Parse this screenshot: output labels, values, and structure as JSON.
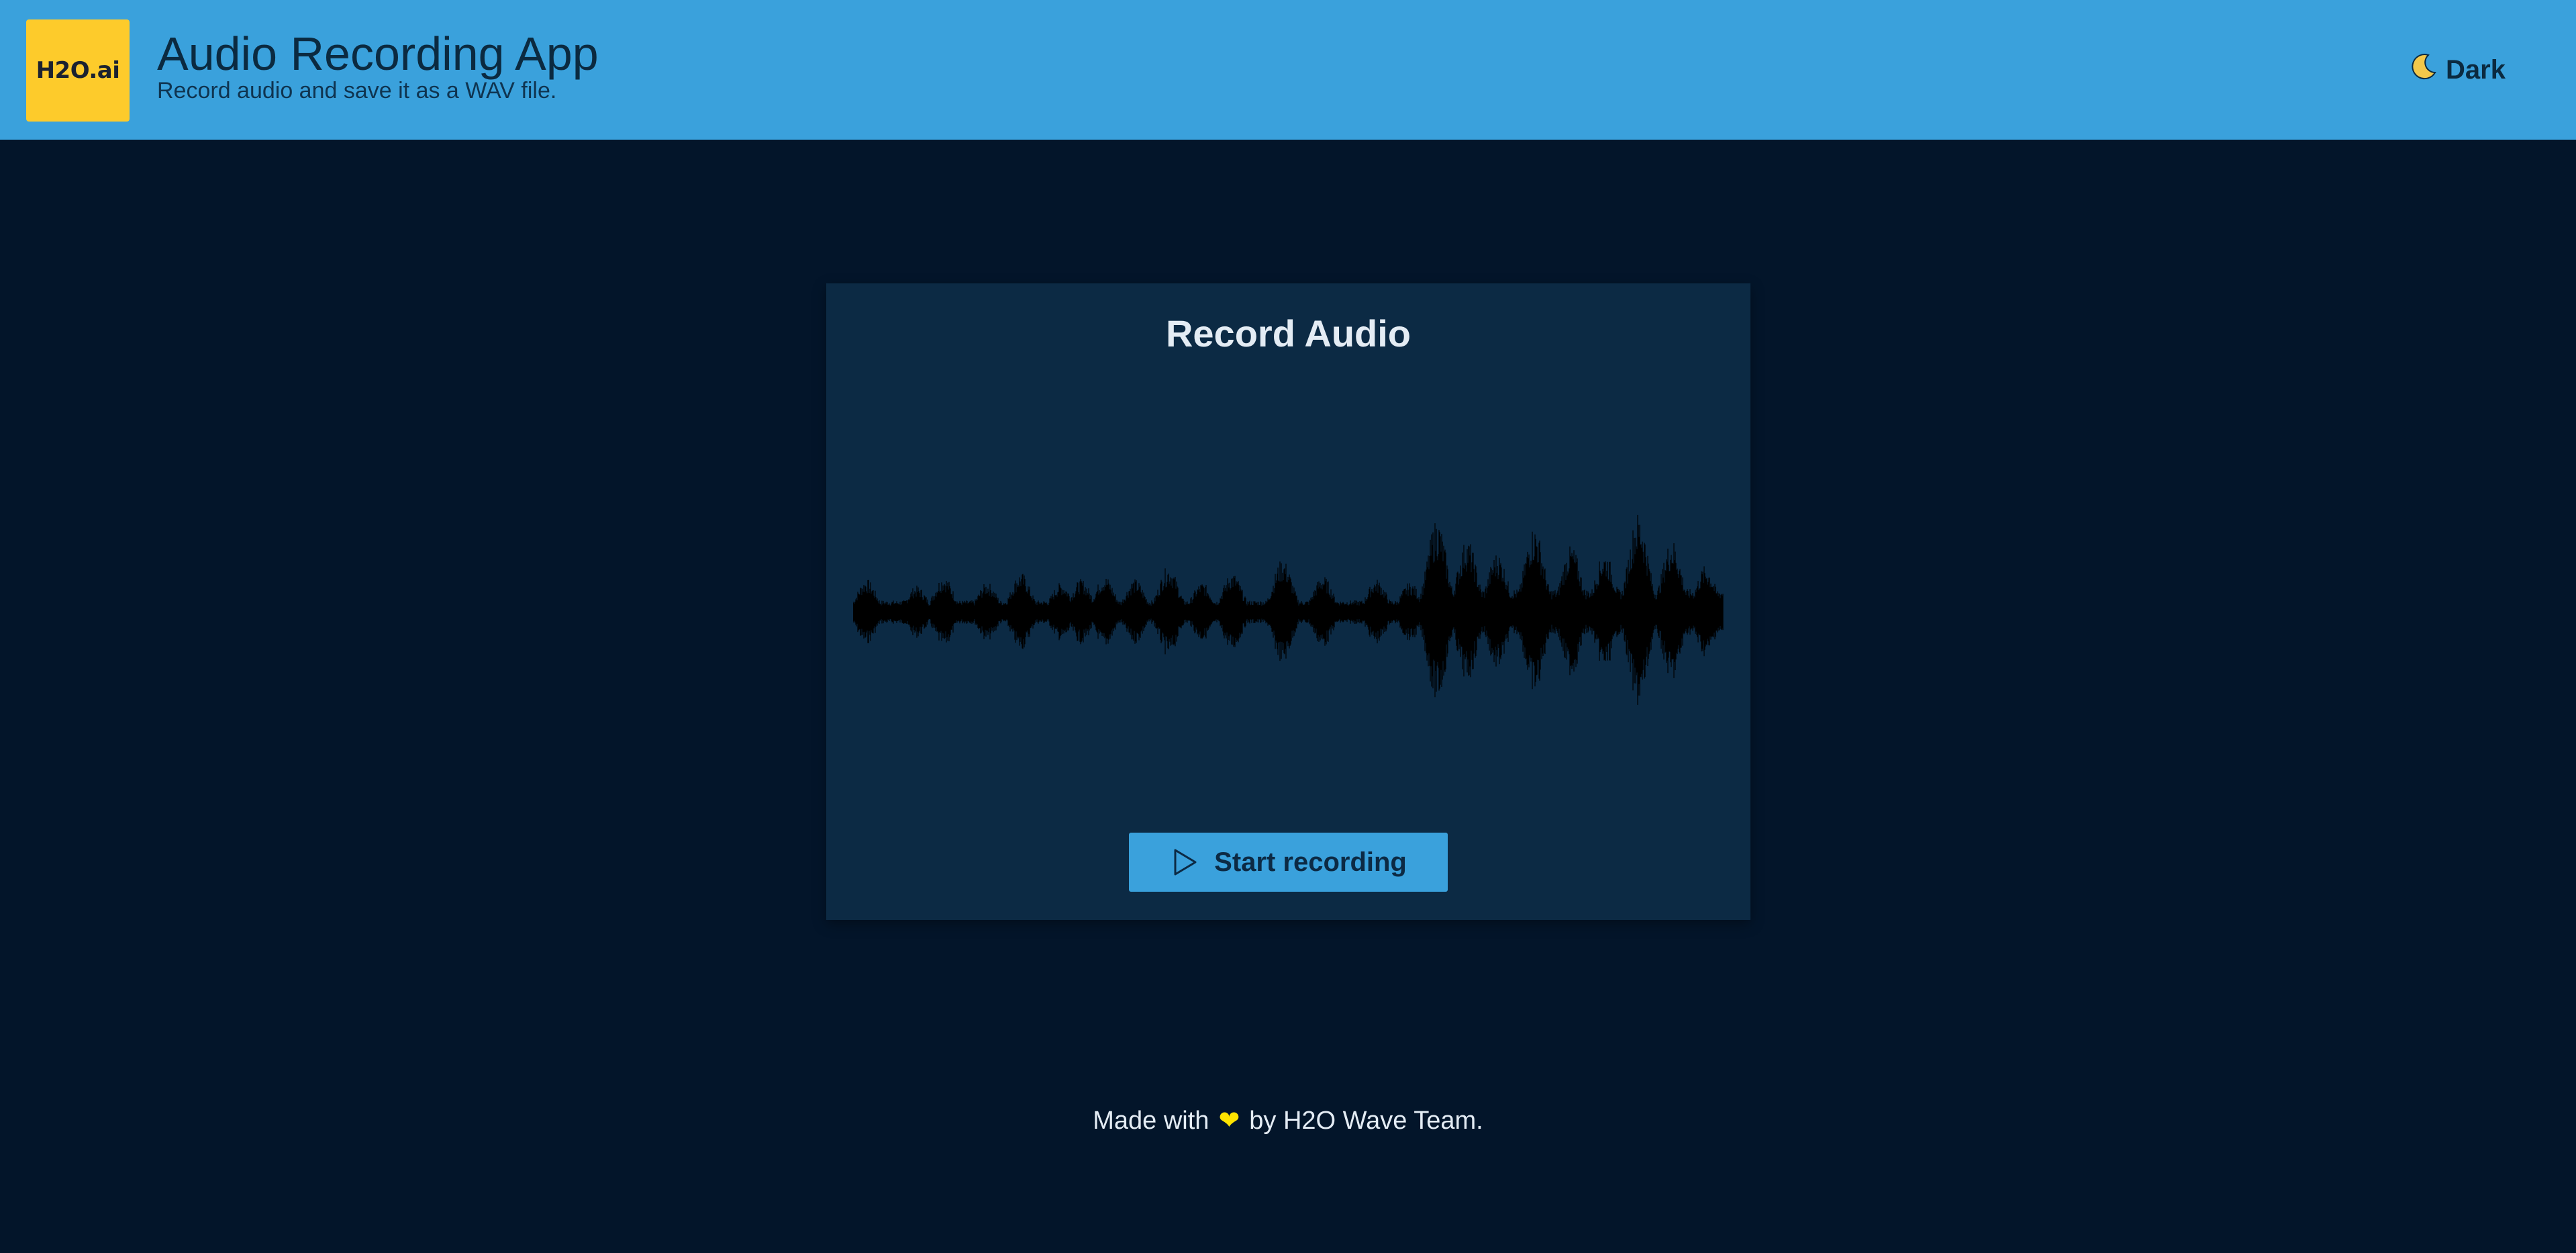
{
  "header": {
    "logo_text": "H2O.ai",
    "title": "Audio Recording App",
    "subtitle": "Record audio and save it as a WAV file.",
    "theme_toggle": {
      "icon": "moon-icon",
      "label": "Dark"
    }
  },
  "card": {
    "title": "Record Audio",
    "record_button": {
      "icon": "play-icon",
      "label": "Start recording"
    }
  },
  "footer": {
    "prefix": "Made with",
    "heart_icon": "heart-icon",
    "suffix": "by H2O Wave Team."
  },
  "colors": {
    "header_bg": "#3aa1dc",
    "page_bg": "#03152a",
    "card_bg": "#0c2a44",
    "logo_bg": "#fdcb2b",
    "heart": "#ffe400",
    "waveform": "#000000"
  }
}
